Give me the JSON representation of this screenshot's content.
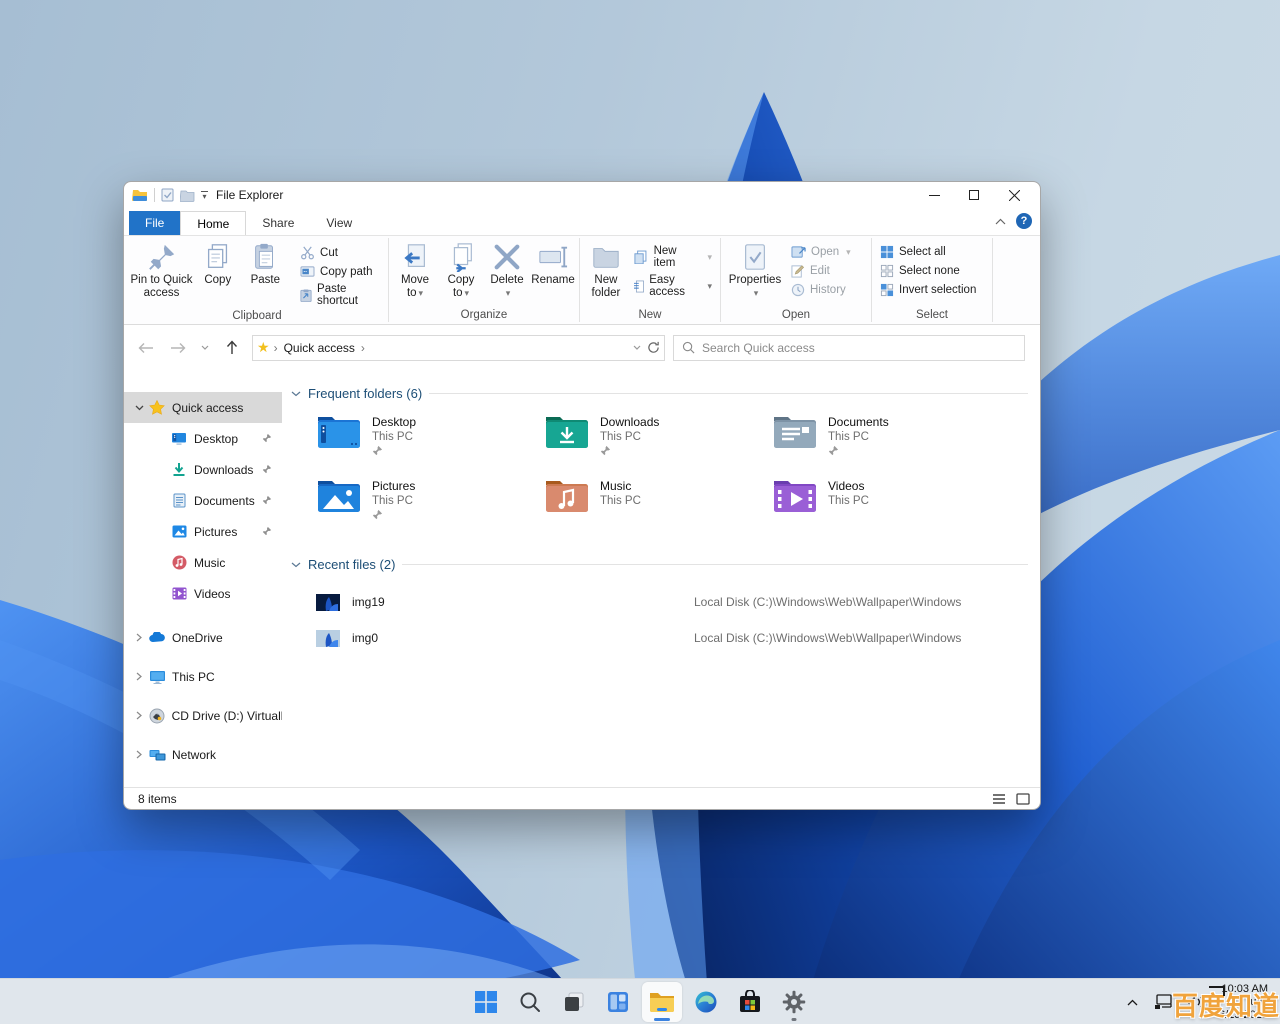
{
  "window": {
    "title": "File Explorer",
    "tabs": [
      "File",
      "Home",
      "Share",
      "View"
    ],
    "ribbon": {
      "clipboard": {
        "label": "Clipboard",
        "pin": "Pin to Quick access",
        "copy": "Copy",
        "paste": "Paste",
        "cut": "Cut",
        "copy_path": "Copy path",
        "paste_shortcut": "Paste shortcut"
      },
      "organize": {
        "label": "Organize",
        "move_to": "Move to",
        "copy_to": "Copy to",
        "del": "Delete",
        "rename": "Rename"
      },
      "new": {
        "label": "New",
        "new_folder": "New folder",
        "new_item": "New item",
        "easy_access": "Easy access"
      },
      "open": {
        "label": "Open",
        "properties": "Properties",
        "open": "Open",
        "edit": "Edit",
        "history": "History"
      },
      "select": {
        "label": "Select",
        "select_all": "Select all",
        "select_none": "Select none",
        "invert_selection": "Invert selection"
      }
    },
    "navbar": {
      "breadcrumb": "Quick access",
      "search_placeholder": "Search Quick access"
    },
    "sidebar": {
      "items": [
        {
          "label": "Quick access"
        },
        {
          "label": "Desktop"
        },
        {
          "label": "Downloads"
        },
        {
          "label": "Documents"
        },
        {
          "label": "Pictures"
        },
        {
          "label": "Music"
        },
        {
          "label": "Videos"
        },
        {
          "label": "OneDrive"
        },
        {
          "label": "This PC"
        },
        {
          "label": "CD Drive (D:) Virtuall"
        },
        {
          "label": "Network"
        }
      ]
    },
    "content": {
      "frequent": {
        "title": "Frequent folders (6)",
        "tiles": [
          {
            "name": "Desktop",
            "location": "This PC",
            "pinned": true
          },
          {
            "name": "Downloads",
            "location": "This PC",
            "pinned": true
          },
          {
            "name": "Documents",
            "location": "This PC",
            "pinned": true
          },
          {
            "name": "Pictures",
            "location": "This PC",
            "pinned": true
          },
          {
            "name": "Music",
            "location": "This PC",
            "pinned": false
          },
          {
            "name": "Videos",
            "location": "This PC",
            "pinned": false
          }
        ]
      },
      "recent": {
        "title": "Recent files (2)",
        "files": [
          {
            "name": "img19",
            "path": "Local Disk (C:)\\Windows\\Web\\Wallpaper\\Windows"
          },
          {
            "name": "img0",
            "path": "Local Disk (C:)\\Windows\\Web\\Wallpaper\\Windows"
          }
        ]
      }
    },
    "statusbar": {
      "count": "8 items"
    }
  },
  "taskbar": {
    "tray": {
      "time": "10:03 AM",
      "day": "Tues",
      "date": "6/15/2021"
    }
  },
  "watermark": {
    "text": "百度知道"
  },
  "icons": {
    "caret": "▾",
    "breadcrumb_sep": "›",
    "star": "★",
    "help": "?"
  },
  "colors": {
    "accent_blue": "#2173c8",
    "selection_gray": "#d9d9d9",
    "section_header_blue": "#1d4e76",
    "watermark_orange": "#f0a33c",
    "taskbar_bg": "#e0e6ec"
  }
}
